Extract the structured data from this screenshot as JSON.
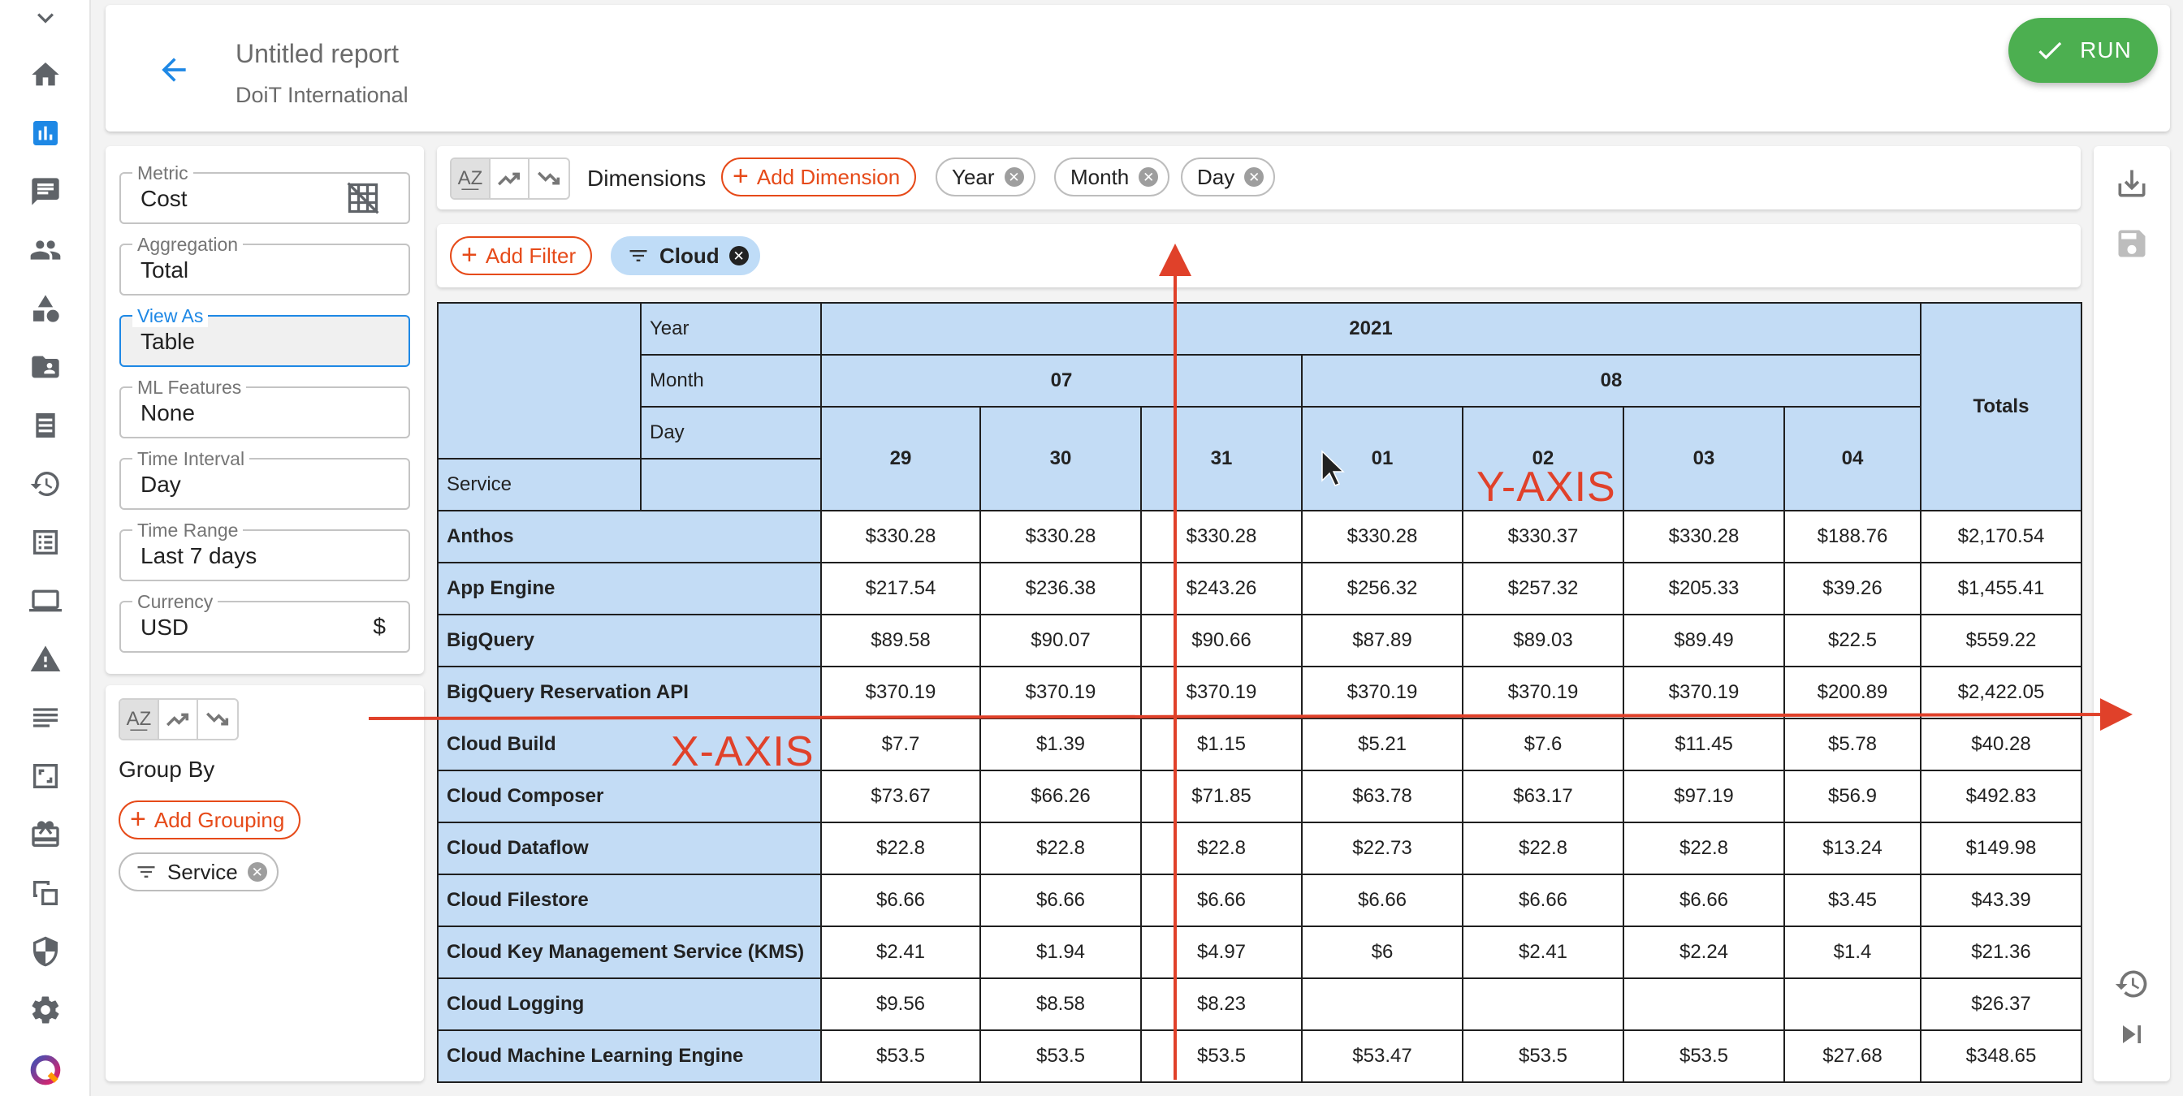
{
  "nav": {
    "icons": [
      "chevron-down-icon",
      "home-icon",
      "chart-icon",
      "message-icon",
      "people-icon",
      "shapes-icon",
      "folder-icon",
      "list-icon",
      "history-icon",
      "invoice-icon",
      "laptop-icon",
      "warning-icon",
      "notes-icon",
      "frame-icon",
      "gift-icon",
      "copy-icon",
      "shield-icon",
      "settings-icon",
      "logo-icon"
    ],
    "active": "chart-icon"
  },
  "header": {
    "title": "Untitled report",
    "subtitle": "DoiT International",
    "run_label": "RUN",
    "run_color": "#4caf50"
  },
  "settings": {
    "metric": {
      "label": "Metric",
      "value": "Cost"
    },
    "aggregation": {
      "label": "Aggregation",
      "value": "Total"
    },
    "view_as": {
      "label": "View As",
      "value": "Table"
    },
    "ml_features": {
      "label": "ML Features",
      "value": "None"
    },
    "time_interval": {
      "label": "Time Interval",
      "value": "Day"
    },
    "time_range": {
      "label": "Time Range",
      "value": "Last 7 days"
    },
    "currency": {
      "label": "Currency",
      "value": "USD",
      "symbol": "$"
    }
  },
  "group_by": {
    "title": "Group By",
    "add_label": "Add Grouping",
    "chips": [
      "Service"
    ]
  },
  "dimensions": {
    "label": "Dimensions",
    "add_label": "Add Dimension",
    "chips": [
      "Year",
      "Month",
      "Day"
    ]
  },
  "filters": {
    "add_label": "Add Filter",
    "chips": [
      "Cloud"
    ]
  },
  "table": {
    "header_labels": {
      "year": "Year",
      "month": "Month",
      "day": "Day",
      "service": "Service",
      "totals": "Totals"
    },
    "year": "2021",
    "months": [
      {
        "label": "07",
        "span": 3
      },
      {
        "label": "08",
        "span": 4
      }
    ],
    "days": [
      "29",
      "30",
      "31",
      "01",
      "02",
      "03",
      "04"
    ],
    "rows": [
      {
        "service": "Anthos",
        "values": [
          "$330.28",
          "$330.28",
          "$330.28",
          "$330.28",
          "$330.37",
          "$330.28",
          "$188.76"
        ],
        "total": "$2,170.54"
      },
      {
        "service": "App Engine",
        "values": [
          "$217.54",
          "$236.38",
          "$243.26",
          "$256.32",
          "$257.32",
          "$205.33",
          "$39.26"
        ],
        "total": "$1,455.41"
      },
      {
        "service": "BigQuery",
        "values": [
          "$89.58",
          "$90.07",
          "$90.66",
          "$87.89",
          "$89.03",
          "$89.49",
          "$22.5"
        ],
        "total": "$559.22"
      },
      {
        "service": "BigQuery Reservation API",
        "values": [
          "$370.19",
          "$370.19",
          "$370.19",
          "$370.19",
          "$370.19",
          "$370.19",
          "$200.89"
        ],
        "total": "$2,422.05"
      },
      {
        "service": "Cloud Build",
        "values": [
          "$7.7",
          "$1.39",
          "$1.15",
          "$5.21",
          "$7.6",
          "$11.45",
          "$5.78"
        ],
        "total": "$40.28"
      },
      {
        "service": "Cloud Composer",
        "values": [
          "$73.67",
          "$66.26",
          "$71.85",
          "$63.78",
          "$63.17",
          "$97.19",
          "$56.9"
        ],
        "total": "$492.83"
      },
      {
        "service": "Cloud Dataflow",
        "values": [
          "$22.8",
          "$22.8",
          "$22.8",
          "$22.73",
          "$22.8",
          "$22.8",
          "$13.24"
        ],
        "total": "$149.98"
      },
      {
        "service": "Cloud Filestore",
        "values": [
          "$6.66",
          "$6.66",
          "$6.66",
          "$6.66",
          "$6.66",
          "$6.66",
          "$3.45"
        ],
        "total": "$43.39"
      },
      {
        "service": "Cloud Key Management Service (KMS)",
        "values": [
          "$2.41",
          "$1.94",
          "$4.97",
          "$6",
          "$2.41",
          "$2.24",
          "$1.4"
        ],
        "total": "$21.36"
      },
      {
        "service": "Cloud Logging",
        "values": [
          "$9.56",
          "$8.58",
          "$8.23",
          "",
          "",
          "",
          ""
        ],
        "total": "$26.37"
      },
      {
        "service": "Cloud Machine Learning Engine",
        "values": [
          "$53.5",
          "$53.5",
          "$53.5",
          "$53.47",
          "$53.5",
          "$53.5",
          "$27.68"
        ],
        "total": "$348.65"
      }
    ]
  },
  "annotations": {
    "x_axis": "X-AXIS",
    "y_axis": "Y-AXIS",
    "color": "#e0412a"
  }
}
